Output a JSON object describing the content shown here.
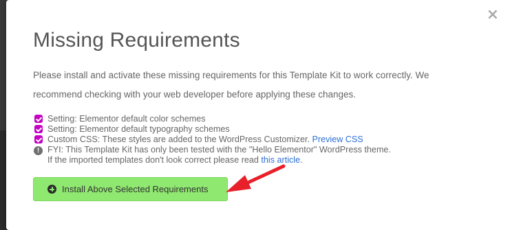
{
  "modal": {
    "close_label": "×",
    "title": "Missing Requirements",
    "intro": "Please install and activate these missing requirements for this Template Kit to work correctly. We recommend checking with your web developer before applying these changes."
  },
  "requirements": [
    {
      "text": "Setting: Elementor default color schemes",
      "checked": true
    },
    {
      "text": "Setting: Elementor default typography schemes",
      "checked": true
    },
    {
      "text": "Custom CSS: These styles are added to the WordPress Customizer.",
      "link": "Preview CSS",
      "checked": true
    }
  ],
  "notice": {
    "icon": "exclamation-circle-icon",
    "line1": "FYI: This Template Kit has only been tested with the \"Hello Elementor\" WordPress theme.",
    "line2_prefix": "If the imported templates don't look correct please read ",
    "line2_link": "this article",
    "line2_suffix": "."
  },
  "install_button": {
    "label": "Install Above Selected Requirements",
    "icon": "plus-circle-icon"
  },
  "colors": {
    "checkbox": "#c300c3",
    "button": "#8fe870",
    "link": "#2a6fd6",
    "arrow": "#e8202a"
  }
}
